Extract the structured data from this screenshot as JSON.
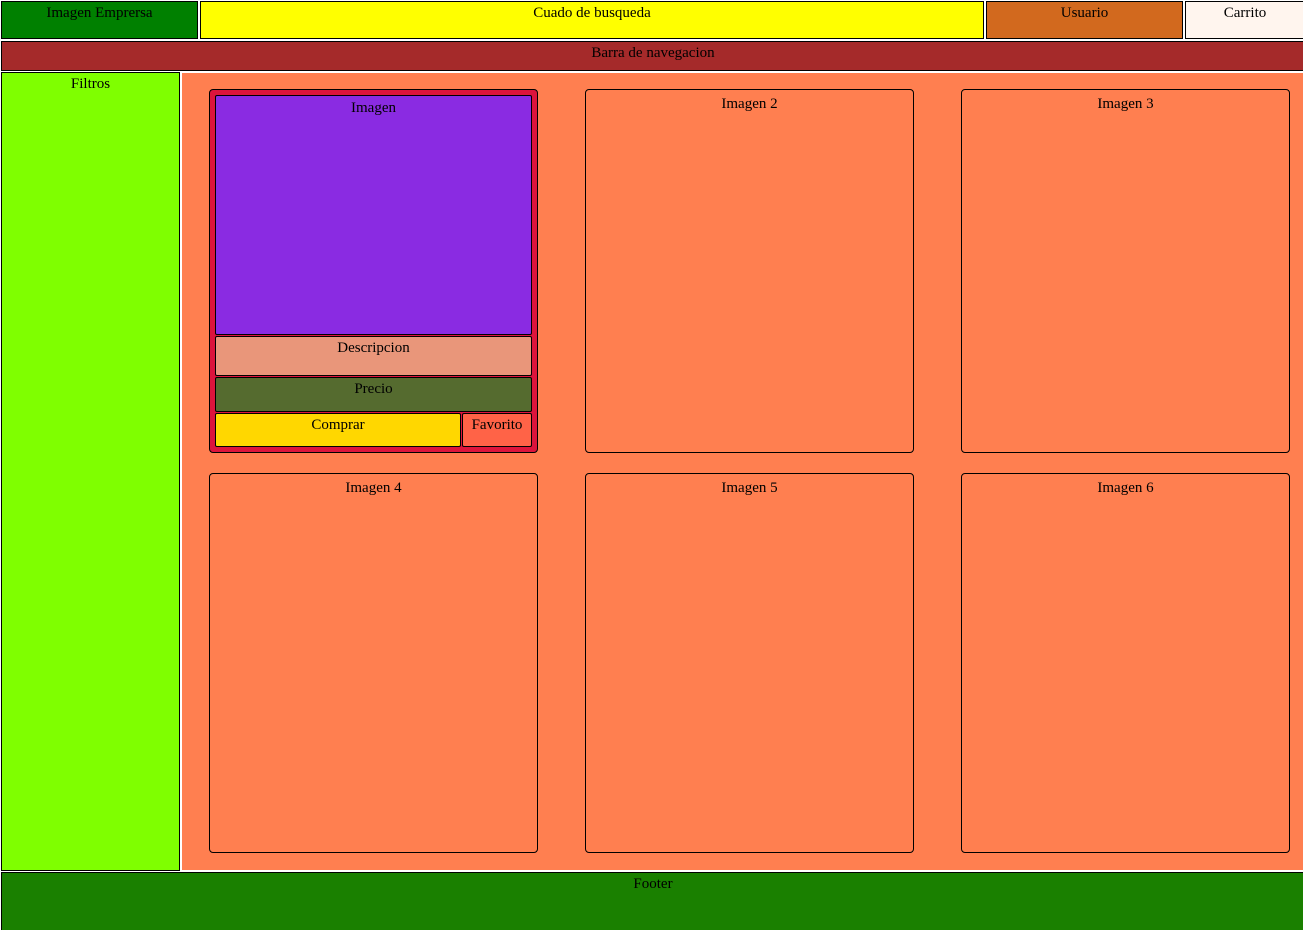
{
  "header": {
    "logo_label": "Imagen Emprersa",
    "search_label": "Cuado de busqueda",
    "user_label": "Usuario",
    "cart_label": "Carrito"
  },
  "navbar": {
    "label": "Barra de navegacion"
  },
  "sidebar": {
    "filters_label": "Filtros"
  },
  "main": {
    "featured_product": {
      "image_label": "Imagen",
      "description_label": "Descripcion",
      "price_label": "Precio",
      "buy_label": "Comprar",
      "favorite_label": "Favorito"
    },
    "products": [
      {
        "label": "Imagen 2"
      },
      {
        "label": "Imagen 3"
      },
      {
        "label": "Imagen 4"
      },
      {
        "label": "Imagen 5"
      },
      {
        "label": "Imagen 6"
      }
    ]
  },
  "footer": {
    "label": "Footer"
  },
  "colors": {
    "logo": "#008000",
    "search": "#ffff00",
    "user": "#d2691e",
    "cart": "#fff5ee",
    "navbar": "#a52a2a",
    "filters": "#7fff00",
    "main": "#ff7f50",
    "featured_card": "#dc143c",
    "image_area": "#8a2be2",
    "description_area": "#e9967a",
    "price_area": "#556b2f",
    "buy_button": "#ffd700",
    "favorite_button": "#ff6347",
    "footer": "#1a8000"
  }
}
